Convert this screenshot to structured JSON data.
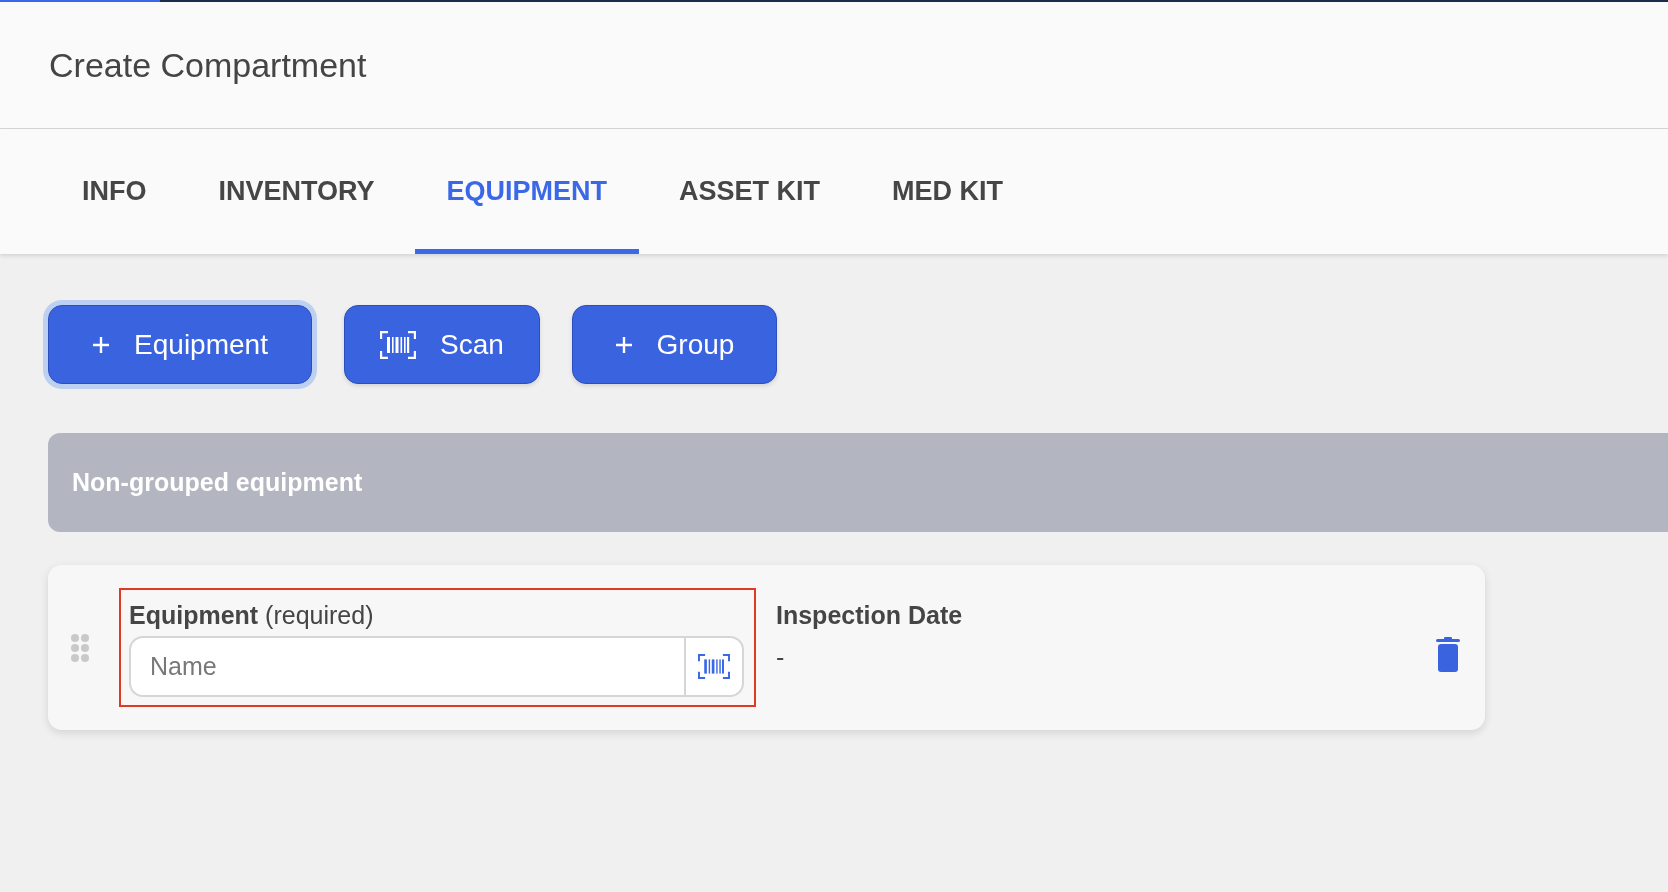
{
  "top_progress": {
    "level": 0.096
  },
  "header": {
    "title": "Create Compartment"
  },
  "tabs": [
    {
      "label": "INFO",
      "selected": false
    },
    {
      "label": "INVENTORY",
      "selected": false
    },
    {
      "label": "EQUIPMENT",
      "selected": true
    },
    {
      "label": "ASSET KIT",
      "selected": false
    },
    {
      "label": "MED KIT",
      "selected": false
    }
  ],
  "actions": [
    {
      "kind": "add",
      "label": "Equipment",
      "focused": true
    },
    {
      "kind": "scan",
      "label": "Scan",
      "focused": false
    },
    {
      "kind": "add",
      "label": "Group",
      "focused": false
    }
  ],
  "group": {
    "title": "Non-grouped equipment",
    "items": [
      {
        "equipment_field": {
          "label": "**Equipment** (required)",
          "placeholder": "Name",
          "invalid": true
        },
        "inspection_date": {
          "label": "Inspection Date",
          "value": "-"
        }
      }
    ]
  }
}
